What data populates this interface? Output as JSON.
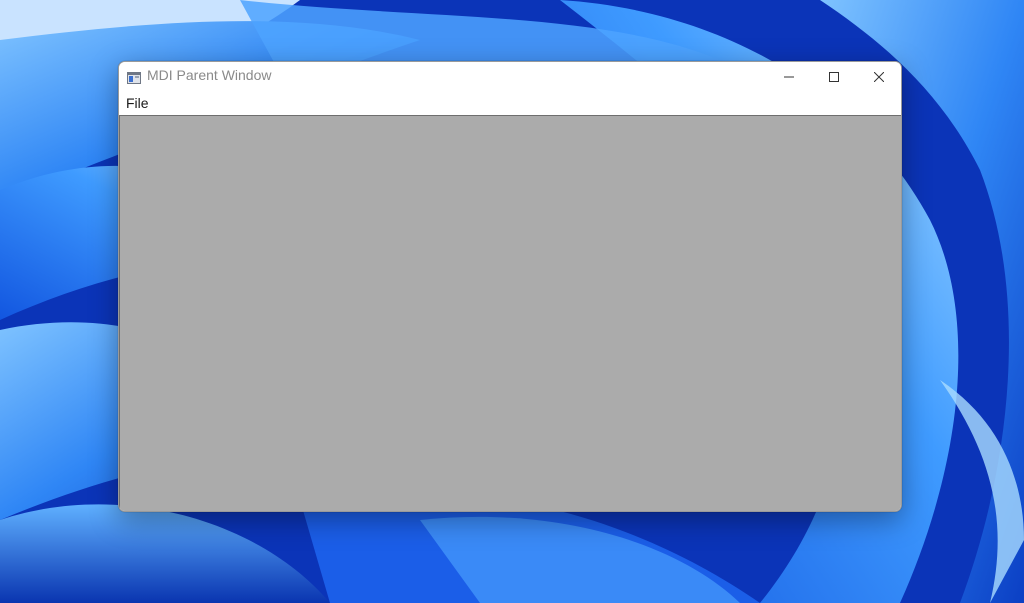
{
  "window": {
    "title": "MDI Parent Window",
    "icon": "application-window-icon"
  },
  "caption_buttons": {
    "minimize_icon": "minimize-icon",
    "maximize_icon": "maximize-icon",
    "close_icon": "close-icon"
  },
  "menu": {
    "items": [
      {
        "label": "File"
      }
    ]
  },
  "mdi_client": {
    "background_color": "#ababab"
  },
  "desktop": {
    "wallpaper": "Windows 11 blue bloom",
    "accent_color": "#1e6cf0"
  }
}
